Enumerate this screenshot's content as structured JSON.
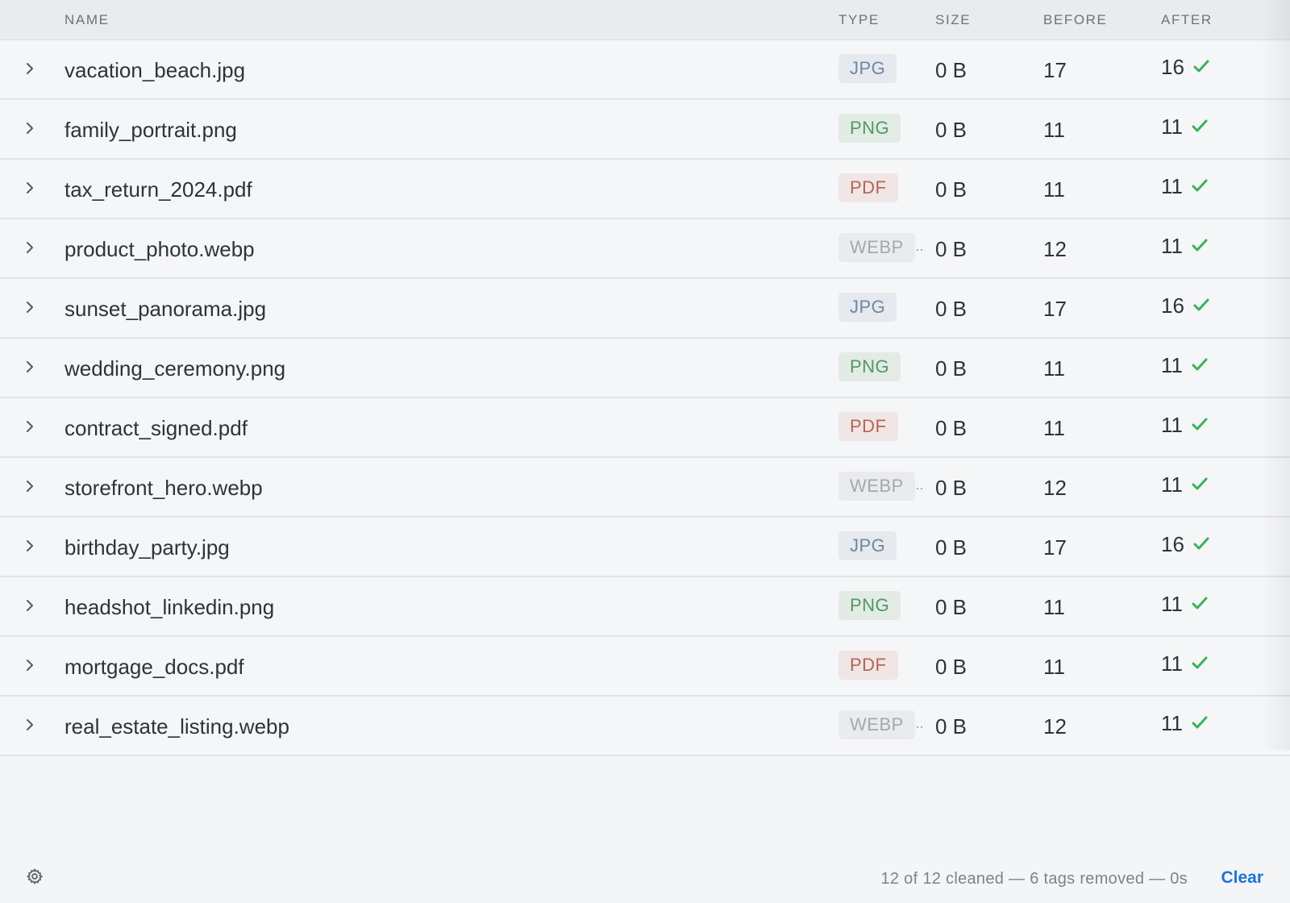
{
  "header": {
    "name": "NAME",
    "type": "TYPE",
    "size": "SIZE",
    "before": "BEFORE",
    "after": "AFTER"
  },
  "rows": [
    {
      "name": "vacation_beach.jpg",
      "type": "JPG",
      "type_class": "jpg",
      "size": "0 B",
      "before": "17",
      "after": "16"
    },
    {
      "name": "family_portrait.png",
      "type": "PNG",
      "type_class": "png",
      "size": "0 B",
      "before": "11",
      "after": "11"
    },
    {
      "name": "tax_return_2024.pdf",
      "type": "PDF",
      "type_class": "pdf",
      "size": "0 B",
      "before": "11",
      "after": "11"
    },
    {
      "name": "product_photo.webp",
      "type": "WEBP",
      "type_class": "webp",
      "size": "0 B",
      "before": "12",
      "after": "11"
    },
    {
      "name": "sunset_panorama.jpg",
      "type": "JPG",
      "type_class": "jpg",
      "size": "0 B",
      "before": "17",
      "after": "16"
    },
    {
      "name": "wedding_ceremony.png",
      "type": "PNG",
      "type_class": "png",
      "size": "0 B",
      "before": "11",
      "after": "11"
    },
    {
      "name": "contract_signed.pdf",
      "type": "PDF",
      "type_class": "pdf",
      "size": "0 B",
      "before": "11",
      "after": "11"
    },
    {
      "name": "storefront_hero.webp",
      "type": "WEBP",
      "type_class": "webp",
      "size": "0 B",
      "before": "12",
      "after": "11"
    },
    {
      "name": "birthday_party.jpg",
      "type": "JPG",
      "type_class": "jpg",
      "size": "0 B",
      "before": "17",
      "after": "16"
    },
    {
      "name": "headshot_linkedin.png",
      "type": "PNG",
      "type_class": "png",
      "size": "0 B",
      "before": "11",
      "after": "11"
    },
    {
      "name": "mortgage_docs.pdf",
      "type": "PDF",
      "type_class": "pdf",
      "size": "0 B",
      "before": "11",
      "after": "11"
    },
    {
      "name": "real_estate_listing.webp",
      "type": "WEBP",
      "type_class": "webp",
      "size": "0 B",
      "before": "12",
      "after": "11"
    }
  ],
  "truncation_marker": "··",
  "footer": {
    "status": "12 of 12 cleaned — 6 tags removed — 0s",
    "clear_label": "Clear",
    "settings_icon": "gear-icon"
  },
  "colors": {
    "check": "#3cb05a",
    "accent": "#1d73d6"
  }
}
